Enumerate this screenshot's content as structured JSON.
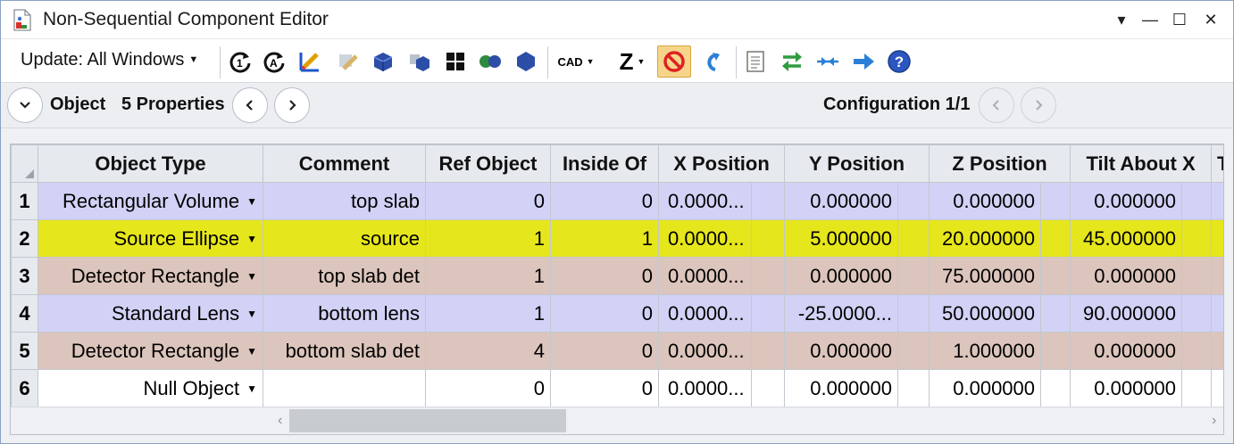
{
  "window": {
    "title": "Non-Sequential Component Editor",
    "controls": [
      "▾",
      "—",
      "☐",
      "✕"
    ]
  },
  "toolbar": {
    "update_label": "Update: All Windows",
    "cad_label": "CAD",
    "z_label": "Z"
  },
  "objectbar": {
    "object_label": "Object",
    "properties_label": "5 Properties",
    "configuration_label": "Configuration 1/1"
  },
  "grid": {
    "columns": [
      "Object Type",
      "Comment",
      "Ref Object",
      "Inside Of",
      "X Position",
      "Y Position",
      "Z Position",
      "Tilt About X",
      "T"
    ],
    "rows": [
      {
        "num": "1",
        "type": "Rectangular Volume",
        "comment": "top slab",
        "ref": "0",
        "inside": "0",
        "x": "0.0000...",
        "y": "0.000000",
        "z": "0.000000",
        "tilt": "0.000000",
        "color": "#d2d2f6"
      },
      {
        "num": "2",
        "type": "Source Ellipse",
        "comment": "source",
        "ref": "1",
        "inside": "1",
        "x": "0.0000...",
        "y": "5.000000",
        "z": "20.000000",
        "tilt": "45.000000",
        "color": "#e6e61c"
      },
      {
        "num": "3",
        "type": "Detector Rectangle",
        "comment": "top slab det",
        "ref": "1",
        "inside": "0",
        "x": "0.0000...",
        "y": "0.000000",
        "z": "75.000000",
        "tilt": "0.000000",
        "color": "#dcc5bc"
      },
      {
        "num": "4",
        "type": "Standard Lens",
        "comment": "bottom lens",
        "ref": "1",
        "inside": "0",
        "x": "0.0000...",
        "y": "-25.0000...",
        "z": "50.000000",
        "tilt": "90.000000",
        "color": "#d2d2f6"
      },
      {
        "num": "5",
        "type": "Detector Rectangle",
        "comment": "bottom slab det",
        "ref": "4",
        "inside": "0",
        "x": "0.0000...",
        "y": "0.000000",
        "z": "1.000000",
        "tilt": "0.000000",
        "color": "#dcc5bc"
      },
      {
        "num": "6",
        "type": "Null Object",
        "comment": "",
        "ref": "0",
        "inside": "0",
        "x": "0.0000...",
        "y": "0.000000",
        "z": "0.000000",
        "tilt": "0.000000",
        "color": "#ffffff"
      }
    ]
  }
}
